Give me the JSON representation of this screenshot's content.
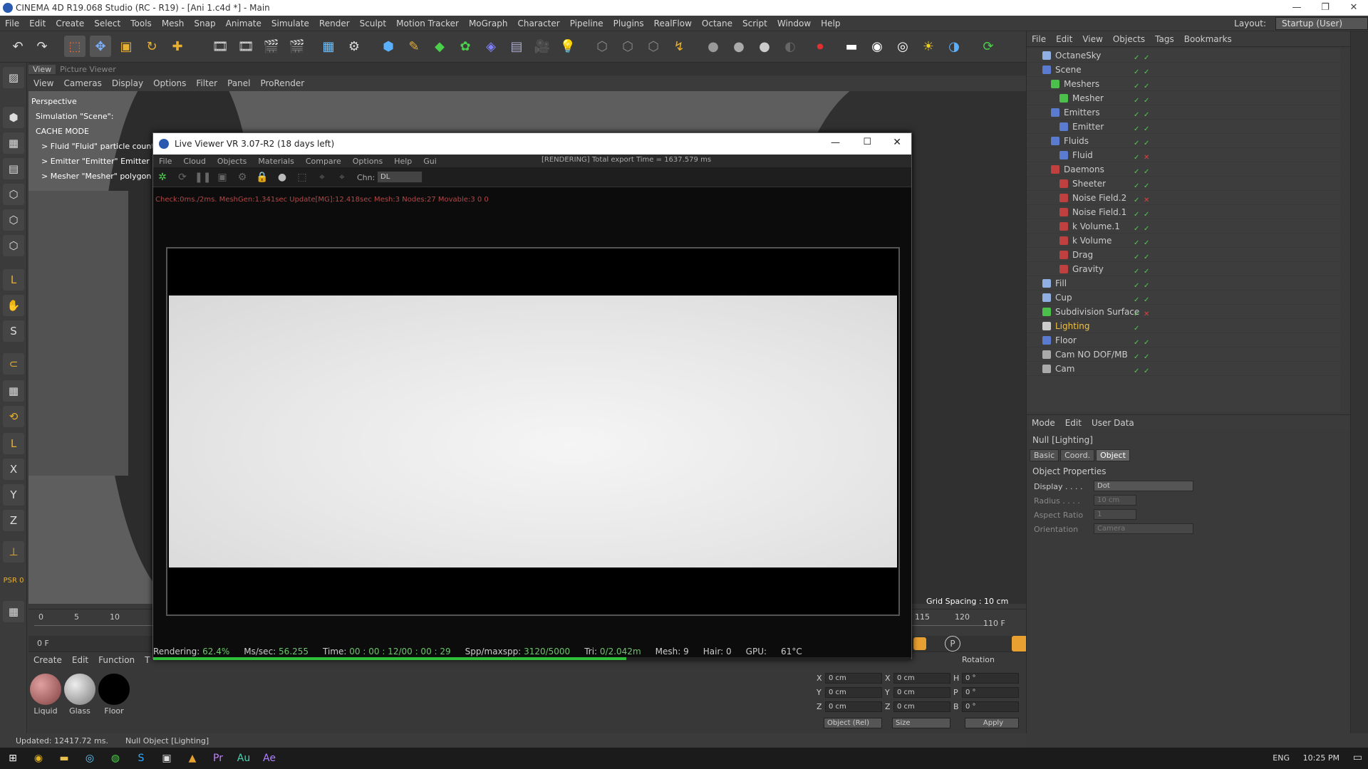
{
  "app": {
    "title": "CINEMA 4D R19.068 Studio (RC - R19) - [Ani 1.c4d *] - Main"
  },
  "menubar": {
    "items": [
      "File",
      "Edit",
      "Create",
      "Select",
      "Tools",
      "Mesh",
      "Snap",
      "Animate",
      "Simulate",
      "Render",
      "Sculpt",
      "Motion Tracker",
      "MoGraph",
      "Character",
      "Pipeline",
      "Plugins",
      "RealFlow",
      "Octane",
      "Script",
      "Window",
      "Help"
    ],
    "layout_label": "Layout:",
    "layout_value": "Startup (User)"
  },
  "viewport": {
    "tabs": [
      "View",
      "Picture Viewer"
    ],
    "menu": [
      "View",
      "Cameras",
      "Display",
      "Options",
      "Filter",
      "Panel",
      "ProRender"
    ],
    "name": "Perspective",
    "info": [
      "Simulation \"Scene\":",
      "CACHE MODE",
      "> Fluid \"Fluid\" particle count:",
      "> Emitter \"Emitter\" Emitter ID:",
      "> Mesher \"Mesher\" polygon co"
    ],
    "grid_spacing": "Grid Spacing : 10 cm"
  },
  "timeline": {
    "ticks": [
      "0",
      "5",
      "10",
      "115",
      "120"
    ],
    "frame_left": "0 F",
    "frame_end": "110 F",
    "frame_field": "0 F"
  },
  "materials": {
    "menu": [
      "Create",
      "Edit",
      "Function",
      "T"
    ],
    "items": [
      {
        "name": "Liquid",
        "color": "#b06060"
      },
      {
        "name": "Glass",
        "color": "#888888"
      },
      {
        "name": "Floor",
        "color": "#000000"
      }
    ]
  },
  "coords": {
    "header": "Rotation",
    "rows": [
      {
        "a": "X",
        "av": "0 cm",
        "b": "X",
        "bv": "0 cm",
        "c": "H",
        "cv": "0 °"
      },
      {
        "a": "Y",
        "av": "0 cm",
        "b": "Y",
        "bv": "0 cm",
        "c": "P",
        "cv": "0 °"
      },
      {
        "a": "Z",
        "av": "0 cm",
        "b": "Z",
        "bv": "0 cm",
        "c": "B",
        "cv": "0 °"
      }
    ],
    "mode": "Object (Rel)",
    "size": "Size",
    "apply": "Apply"
  },
  "status": {
    "updated": "Updated: 12417.72 ms.",
    "object": "Null Object [Lighting]"
  },
  "objects": {
    "menu": [
      "File",
      "Edit",
      "View",
      "Objects",
      "Tags",
      "Bookmarks"
    ],
    "rows": [
      {
        "name": "OctaneSky",
        "indent": 0,
        "color": "#8fb0e0",
        "mark": "✓",
        "mark2": "✓"
      },
      {
        "name": "Scene",
        "indent": 0,
        "color": "#5a7bd0",
        "mark": "✓",
        "mark2": "✓"
      },
      {
        "name": "Meshers",
        "indent": 1,
        "color": "#4bc04b",
        "mark": "✓",
        "mark2": "✓"
      },
      {
        "name": "Mesher",
        "indent": 2,
        "color": "#4bc04b",
        "mark": "✓",
        "mark2": "✓"
      },
      {
        "name": "Emitters",
        "indent": 1,
        "color": "#5a7bd0",
        "mark": "✓",
        "mark2": "✓"
      },
      {
        "name": "Emitter",
        "indent": 2,
        "color": "#5a7bd0",
        "mark": "✓",
        "mark2": "✓"
      },
      {
        "name": "Fluids",
        "indent": 1,
        "color": "#5a7bd0",
        "mark": "✓",
        "mark2": "✓"
      },
      {
        "name": "Fluid",
        "indent": 2,
        "color": "#5a7bd0",
        "mark": "✓",
        "mark2": "✕"
      },
      {
        "name": "Daemons",
        "indent": 1,
        "color": "#c04040",
        "mark": "✓",
        "mark2": "✓"
      },
      {
        "name": "Sheeter",
        "indent": 2,
        "color": "#c04040",
        "mark": "✓",
        "mark2": "✓"
      },
      {
        "name": "Noise Field.2",
        "indent": 2,
        "color": "#c04040",
        "mark": "✓",
        "mark2": "✕"
      },
      {
        "name": "Noise Field.1",
        "indent": 2,
        "color": "#c04040",
        "mark": "✓",
        "mark2": "✓"
      },
      {
        "name": "k Volume.1",
        "indent": 2,
        "color": "#c04040",
        "mark": "✓",
        "mark2": "✓"
      },
      {
        "name": "k Volume",
        "indent": 2,
        "color": "#c04040",
        "mark": "✓",
        "mark2": "✓"
      },
      {
        "name": "Drag",
        "indent": 2,
        "color": "#c04040",
        "mark": "✓",
        "mark2": "✓"
      },
      {
        "name": "Gravity",
        "indent": 2,
        "color": "#c04040",
        "mark": "✓",
        "mark2": "✓"
      },
      {
        "name": "Fill",
        "indent": 0,
        "color": "#8fb0e0",
        "mark": "✓",
        "mark2": "✓"
      },
      {
        "name": "Cup",
        "indent": 0,
        "color": "#8fb0e0",
        "mark": "✓",
        "mark2": "✓"
      },
      {
        "name": "Subdivision Surface",
        "indent": 0,
        "color": "#4bc04b",
        "mark": "✓",
        "mark2": "✕"
      },
      {
        "name": "Lighting",
        "indent": 0,
        "color": "#cccccc",
        "mark": "✓",
        "mark2": "",
        "selected": true
      },
      {
        "name": "Floor",
        "indent": 0,
        "color": "#5a7bd0",
        "mark": "✓",
        "mark2": "✓"
      },
      {
        "name": "Cam NO DOF/MB",
        "indent": 0,
        "color": "#aaaaaa",
        "mark": "✓",
        "mark2": "✓"
      },
      {
        "name": "Cam",
        "indent": 0,
        "color": "#aaaaaa",
        "mark": "✓",
        "mark2": "✓"
      }
    ]
  },
  "attributes": {
    "menu": [
      "Mode",
      "Edit",
      "User Data"
    ],
    "object_name": "Null [Lighting]",
    "tabs": [
      "Basic",
      "Coord.",
      "Object"
    ],
    "section": "Object Properties",
    "props": [
      {
        "label": "Display . . . .",
        "value": "Dot"
      },
      {
        "label": "Radius . . . .",
        "value": "10 cm"
      },
      {
        "label": "Aspect Ratio",
        "value": "1"
      },
      {
        "label": "Orientation",
        "value": "Camera"
      }
    ]
  },
  "liveviewer": {
    "title": "Live Viewer VR 3.07-R2 (18 days left)",
    "menu": [
      "File",
      "Cloud",
      "Objects",
      "Materials",
      "Compare",
      "Options",
      "Help",
      "Gui"
    ],
    "status": "[RENDERING] Total export Time = 1637.579 ms",
    "channel_label": "Chn:",
    "channel_value": "DL",
    "check": "Check:0ms./2ms. MeshGen:1.341sec Update[MG]:12.418sec Mesh:3 Nodes:27 Movable:3  0 0",
    "rendering_label": "Rendering:",
    "rendering_value": "62.4%",
    "progress": 0.624,
    "mssec_label": "Ms/sec:",
    "mssec_value": "56.255",
    "time_label": "Time:",
    "time_value": "00 : 00 : 12/00 : 00 : 29",
    "spp_label": "Spp/maxspp:",
    "spp_value": "3120/5000",
    "tri_label": "Tri:",
    "tri_value": "0/2.042m",
    "mesh": "Mesh: 9",
    "hair": "Hair: 0",
    "gpu_label": "GPU:",
    "temp": "61°C"
  },
  "taskbar": {
    "lang": "ENG",
    "clock": "10:25 PM"
  }
}
